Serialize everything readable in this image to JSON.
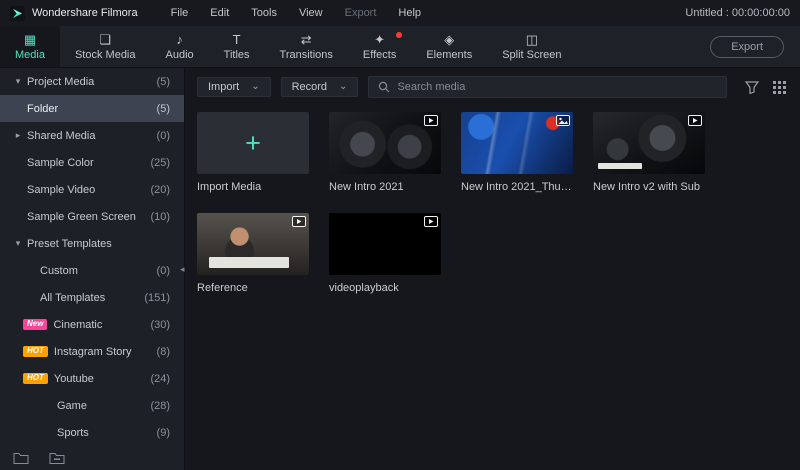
{
  "app": {
    "name": "Wondershare Filmora",
    "project_status": "Untitled : 00:00:00:00",
    "menu": [
      {
        "label": "File"
      },
      {
        "label": "Edit"
      },
      {
        "label": "Tools"
      },
      {
        "label": "View"
      },
      {
        "label": "Export",
        "disabled": true
      },
      {
        "label": "Help"
      }
    ]
  },
  "tabs": [
    {
      "label": "Media",
      "active": true
    },
    {
      "label": "Stock Media"
    },
    {
      "label": "Audio"
    },
    {
      "label": "Titles"
    },
    {
      "label": "Transitions"
    },
    {
      "label": "Effects",
      "notification": true
    },
    {
      "label": "Elements"
    },
    {
      "label": "Split Screen"
    }
  ],
  "export_button_label": "Export",
  "sidebar": {
    "items": [
      {
        "label": "Project Media",
        "count": "(5)"
      },
      {
        "label": "Folder",
        "count": "(5)",
        "selected": true
      },
      {
        "label": "Shared Media",
        "count": "(0)"
      },
      {
        "label": "Sample Color",
        "count": "(25)"
      },
      {
        "label": "Sample Video",
        "count": "(20)"
      },
      {
        "label": "Sample Green Screen",
        "count": "(10)"
      },
      {
        "label": "Preset Templates",
        "count": ""
      },
      {
        "label": "Custom",
        "count": "(0)"
      },
      {
        "label": "All Templates",
        "count": "(151)"
      },
      {
        "label": "Cinematic",
        "count": "(30)",
        "badge": "New"
      },
      {
        "label": "Instagram Story",
        "count": "(8)",
        "badge": "HOT"
      },
      {
        "label": "Youtube",
        "count": "(24)",
        "badge": "HOT"
      },
      {
        "label": "Game",
        "count": "(28)"
      },
      {
        "label": "Sports",
        "count": "(9)"
      }
    ]
  },
  "content_toolbar": {
    "import_label": "Import",
    "record_label": "Record",
    "search_placeholder": "Search media"
  },
  "media": {
    "items": [
      {
        "label": "Import Media",
        "type": "import"
      },
      {
        "label": "New Intro 2021",
        "type": "video"
      },
      {
        "label": "New Intro 2021_Thum...",
        "type": "image"
      },
      {
        "label": "New Intro v2 with Sub",
        "type": "video"
      },
      {
        "label": "Reference",
        "type": "video"
      },
      {
        "label": "videoplayback",
        "type": "video"
      }
    ]
  },
  "icons": {
    "media": "▦",
    "stock_media": "❏",
    "audio": "♪",
    "titles": "T",
    "transitions": "⇄",
    "effects": "✦",
    "elements": "◈",
    "split_screen": "◫",
    "chevron_down": "⌄",
    "triangle_down": "▾",
    "triangle_right": "▸",
    "collapse_left": "◂",
    "plus": "+"
  },
  "colors": {
    "accent": "#4fe0c0",
    "notification_dot": "#ff3b30",
    "badge_new": "#f5479a",
    "badge_hot": "#ffa200"
  }
}
